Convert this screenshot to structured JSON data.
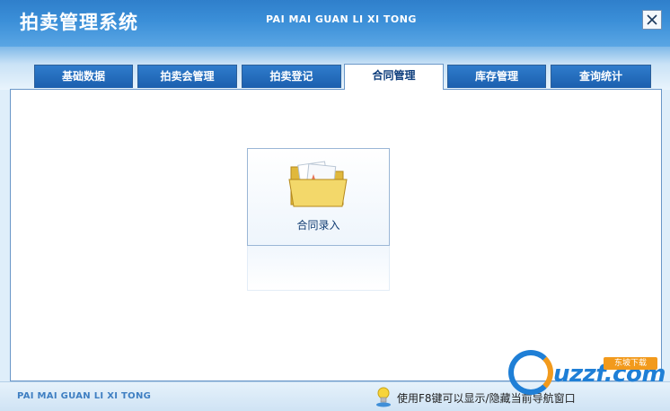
{
  "header": {
    "title": "拍卖管理系统",
    "subtitle": "PAI MAI GUAN LI XI TONG",
    "close_icon": "close-icon"
  },
  "tabs": [
    {
      "label": "基础数据",
      "active": false
    },
    {
      "label": "拍卖会管理",
      "active": false
    },
    {
      "label": "拍卖登记",
      "active": false
    },
    {
      "label": "合同管理",
      "active": true
    },
    {
      "label": "库存管理",
      "active": false
    },
    {
      "label": "查询统计",
      "active": false
    }
  ],
  "content": {
    "items": [
      {
        "label": "合同录入",
        "icon": "folder-icon"
      }
    ]
  },
  "footer": {
    "brand": "PAI MAI GUAN LI XI TONG",
    "hint_icon": "lightbulb-icon",
    "hint": "使用F8键可以显示/隐藏当前导航窗口"
  },
  "watermark": {
    "text": "uzzf.com",
    "badge": "东坡下载"
  },
  "colors": {
    "title_bar": "#2f7fcb",
    "tab_bg": "#1b5fae",
    "active_tab_text": "#0d3d7c",
    "watermark_blue": "#1f7fd6",
    "watermark_orange": "#f29a1c"
  }
}
